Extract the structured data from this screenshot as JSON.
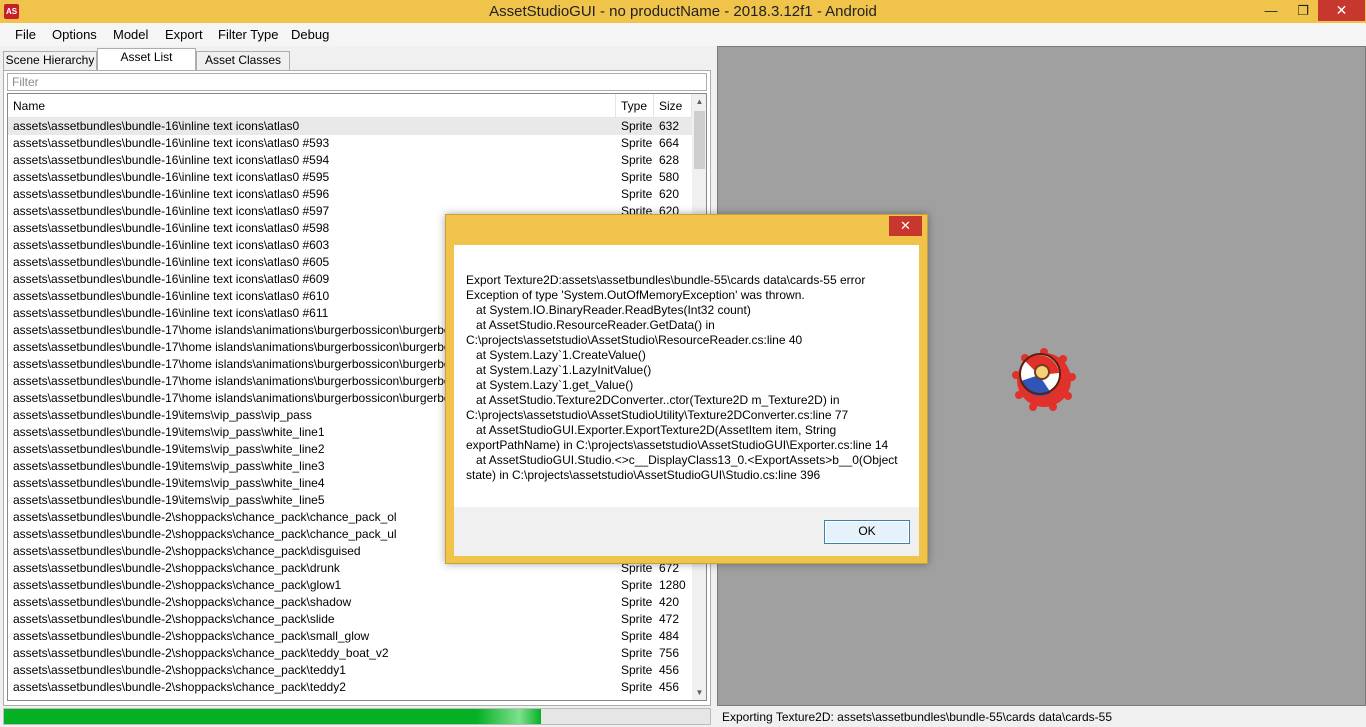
{
  "window": {
    "title": "AssetStudioGUI - no productName - 2018.3.12f1 - Android",
    "icon_text": "AS",
    "minimize_glyph": "—",
    "maximize_glyph": "❐",
    "close_glyph": "✕"
  },
  "menu": [
    "File",
    "Options",
    "Model",
    "Export",
    "Filter Type",
    "Debug"
  ],
  "tabs": [
    "Scene Hierarchy",
    "Asset List",
    "Asset Classes"
  ],
  "active_tab": "Asset List",
  "filter": {
    "placeholder": "Filter"
  },
  "list": {
    "columns": [
      "Name",
      "Type",
      "Size"
    ],
    "rows": [
      {
        "name": "assets\\assetbundles\\bundle-16\\inline text icons\\atlas0",
        "type": "Sprite",
        "size": "632"
      },
      {
        "name": "assets\\assetbundles\\bundle-16\\inline text icons\\atlas0 #593",
        "type": "Sprite",
        "size": "664"
      },
      {
        "name": "assets\\assetbundles\\bundle-16\\inline text icons\\atlas0 #594",
        "type": "Sprite",
        "size": "628"
      },
      {
        "name": "assets\\assetbundles\\bundle-16\\inline text icons\\atlas0 #595",
        "type": "Sprite",
        "size": "580"
      },
      {
        "name": "assets\\assetbundles\\bundle-16\\inline text icons\\atlas0 #596",
        "type": "Sprite",
        "size": "620"
      },
      {
        "name": "assets\\assetbundles\\bundle-16\\inline text icons\\atlas0 #597",
        "type": "Sprite",
        "size": "620"
      },
      {
        "name": "assets\\assetbundles\\bundle-16\\inline text icons\\atlas0 #598",
        "type": "",
        "size": ""
      },
      {
        "name": "assets\\assetbundles\\bundle-16\\inline text icons\\atlas0 #603",
        "type": "",
        "size": ""
      },
      {
        "name": "assets\\assetbundles\\bundle-16\\inline text icons\\atlas0 #605",
        "type": "",
        "size": ""
      },
      {
        "name": "assets\\assetbundles\\bundle-16\\inline text icons\\atlas0 #609",
        "type": "",
        "size": ""
      },
      {
        "name": "assets\\assetbundles\\bundle-16\\inline text icons\\atlas0 #610",
        "type": "",
        "size": ""
      },
      {
        "name": "assets\\assetbundles\\bundle-16\\inline text icons\\atlas0 #611",
        "type": "",
        "size": ""
      },
      {
        "name": "assets\\assetbundles\\bundle-17\\home islands\\animations\\burgerbossicon\\burgerboss sprite",
        "type": "",
        "size": ""
      },
      {
        "name": "assets\\assetbundles\\bundle-17\\home islands\\animations\\burgerbossicon\\burgerboss sprite",
        "type": "",
        "size": ""
      },
      {
        "name": "assets\\assetbundles\\bundle-17\\home islands\\animations\\burgerbossicon\\burgerboss sprite",
        "type": "",
        "size": ""
      },
      {
        "name": "assets\\assetbundles\\bundle-17\\home islands\\animations\\burgerbossicon\\burgerboss sprite",
        "type": "",
        "size": ""
      },
      {
        "name": "assets\\assetbundles\\bundle-17\\home islands\\animations\\burgerbossicon\\burgerboss sprite",
        "type": "",
        "size": ""
      },
      {
        "name": "assets\\assetbundles\\bundle-19\\items\\vip_pass\\vip_pass",
        "type": "",
        "size": ""
      },
      {
        "name": "assets\\assetbundles\\bundle-19\\items\\vip_pass\\white_line1",
        "type": "",
        "size": ""
      },
      {
        "name": "assets\\assetbundles\\bundle-19\\items\\vip_pass\\white_line2",
        "type": "",
        "size": ""
      },
      {
        "name": "assets\\assetbundles\\bundle-19\\items\\vip_pass\\white_line3",
        "type": "",
        "size": ""
      },
      {
        "name": "assets\\assetbundles\\bundle-19\\items\\vip_pass\\white_line4",
        "type": "",
        "size": ""
      },
      {
        "name": "assets\\assetbundles\\bundle-19\\items\\vip_pass\\white_line5",
        "type": "",
        "size": ""
      },
      {
        "name": "assets\\assetbundles\\bundle-2\\shoppacks\\chance_pack\\chance_pack_ol",
        "type": "",
        "size": ""
      },
      {
        "name": "assets\\assetbundles\\bundle-2\\shoppacks\\chance_pack\\chance_pack_ul",
        "type": "",
        "size": ""
      },
      {
        "name": "assets\\assetbundles\\bundle-2\\shoppacks\\chance_pack\\disguised",
        "type": "",
        "size": ""
      },
      {
        "name": "assets\\assetbundles\\bundle-2\\shoppacks\\chance_pack\\drunk",
        "type": "Sprite",
        "size": "672"
      },
      {
        "name": "assets\\assetbundles\\bundle-2\\shoppacks\\chance_pack\\glow1",
        "type": "Sprite",
        "size": "1280"
      },
      {
        "name": "assets\\assetbundles\\bundle-2\\shoppacks\\chance_pack\\shadow",
        "type": "Sprite",
        "size": "420"
      },
      {
        "name": "assets\\assetbundles\\bundle-2\\shoppacks\\chance_pack\\slide",
        "type": "Sprite",
        "size": "472"
      },
      {
        "name": "assets\\assetbundles\\bundle-2\\shoppacks\\chance_pack\\small_glow",
        "type": "Sprite",
        "size": "484"
      },
      {
        "name": "assets\\assetbundles\\bundle-2\\shoppacks\\chance_pack\\teddy_boat_v2",
        "type": "Sprite",
        "size": "756"
      },
      {
        "name": "assets\\assetbundles\\bundle-2\\shoppacks\\chance_pack\\teddy1",
        "type": "Sprite",
        "size": "456"
      },
      {
        "name": "assets\\assetbundles\\bundle-2\\shoppacks\\chance_pack\\teddy2",
        "type": "Sprite",
        "size": "456"
      }
    ]
  },
  "progress": {
    "fraction": 0.76
  },
  "status_text": "Exporting Texture2D: assets\\assetbundles\\bundle-55\\cards data\\cards-55",
  "dialog": {
    "close_glyph": "✕",
    "message": "Export Texture2D:assets\\assetbundles\\bundle-55\\cards data\\cards-55 error\nException of type 'System.OutOfMemoryException' was thrown.\n   at System.IO.BinaryReader.ReadBytes(Int32 count)\n   at AssetStudio.ResourceReader.GetData() in C:\\projects\\assetstudio\\AssetStudio\\ResourceReader.cs:line 40\n   at System.Lazy`1.CreateValue()\n   at System.Lazy`1.LazyInitValue()\n   at System.Lazy`1.get_Value()\n   at AssetStudio.Texture2DConverter..ctor(Texture2D m_Texture2D) in C:\\projects\\assetstudio\\AssetStudioUtility\\Texture2DConverter.cs:line 77\n   at AssetStudioGUI.Exporter.ExportTexture2D(AssetItem item, String exportPathName) in C:\\projects\\assetstudio\\AssetStudioGUI\\Exporter.cs:line 14\n   at AssetStudioGUI.Studio.<>c__DisplayClass13_0.<ExportAssets>b__0(Object state) in C:\\projects\\assetstudio\\AssetStudioGUI\\Studio.cs:line 396",
    "ok_label": "OK"
  },
  "colors": {
    "titlebar": "#f0c34a",
    "close_button": "#c7372e",
    "preview_bg": "#a0a0a0",
    "progress_fill": "#06b025"
  },
  "icons": [
    "app-icon",
    "minimize-icon",
    "maximize-icon",
    "close-icon",
    "scroll-up-icon",
    "scroll-down-icon",
    "sprite-preview"
  ]
}
